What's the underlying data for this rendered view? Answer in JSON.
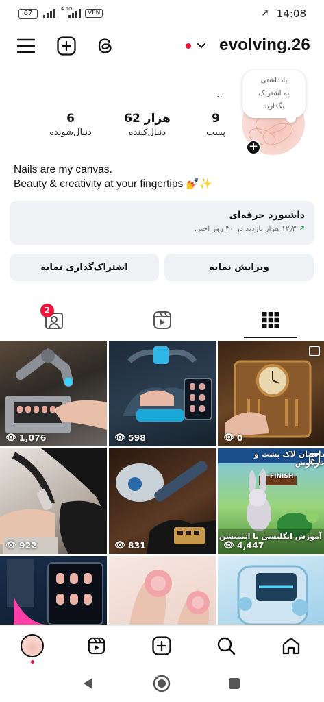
{
  "status_bar": {
    "battery": "67",
    "network": "4.5G",
    "vpn": "VPN",
    "time": "14:08"
  },
  "header": {
    "username": "evolving.26",
    "icons": [
      "menu-icon",
      "add-post-icon",
      "threads-icon",
      "chevron-down-icon"
    ]
  },
  "profile": {
    "note_text": [
      "یادداشتی",
      "به اشتراک",
      "بگذارید"
    ],
    "stats": [
      {
        "value": "9",
        "label": "پست"
      },
      {
        "value": "62 هزار",
        "label": "دنبال‌کننده"
      },
      {
        "value": "6",
        "label": "دنبال‌شونده"
      }
    ],
    "bio_line1": "Nails are my canvas.",
    "bio_line2": "Beauty & creativity at your fingertips 💅✨",
    "dots": ".."
  },
  "dashboard": {
    "title": "داشبورد حرفه‌ای",
    "subtitle": "۱۲٫۳ هزار بازدید در ۳۰ روز اخیر."
  },
  "buttons": {
    "edit": "ویرایش نمایه",
    "share": "اشتراک‌گذاری نمایه"
  },
  "tabs": {
    "tagged_badge": "2",
    "active": "grid"
  },
  "posts": [
    {
      "views": "1,076",
      "subject": "robotic arm manicure machine",
      "multi": false
    },
    {
      "views": "598",
      "subject": "futuristic nail machine with tablet",
      "multi": false
    },
    {
      "views": "0",
      "subject": "steampunk nail machine",
      "multi": true
    },
    {
      "views": "922",
      "subject": "nail drill in gloved hand",
      "multi": false
    },
    {
      "views": "831",
      "subject": "nail drill pen on desk",
      "multi": false
    },
    {
      "views": "4,447",
      "subject": "rabbit and turtle animation",
      "multi": true,
      "caption_top": "داستان لاک پشت و خرگوش",
      "caption_bottom": "آموزش انگلیسی با انیمیشن",
      "banner": "FINISH"
    },
    {
      "views": "",
      "subject": "tablet nail printer",
      "multi": false
    },
    {
      "views": "",
      "subject": "rose nail art",
      "multi": false
    },
    {
      "views": "",
      "subject": "nail extension machine",
      "multi": false
    }
  ],
  "colors": {
    "accent_red": "#e8163a",
    "panel_gray": "#eff1f4",
    "trend_green": "#2ba14a"
  }
}
